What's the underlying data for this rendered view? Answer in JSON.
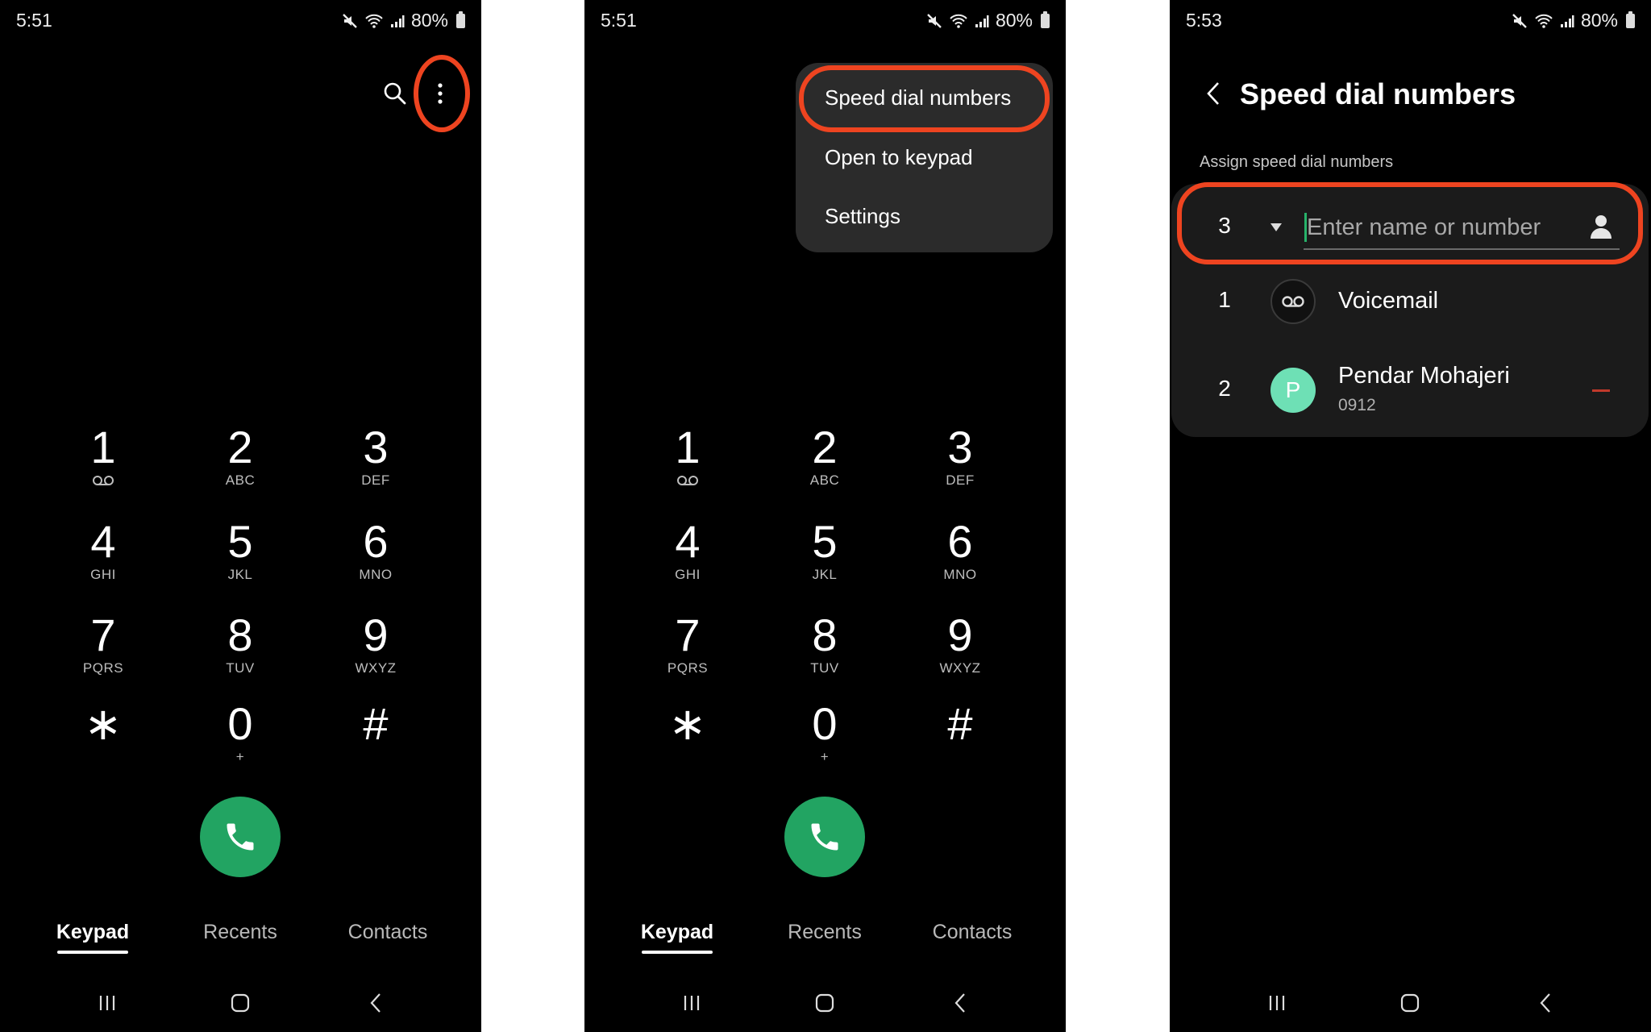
{
  "accent": {
    "callout": "#ee4420",
    "call_green": "#22a462",
    "avatar_mint": "#6ee0b5",
    "remove_red": "#c0392b",
    "caret_green": "#27b36a"
  },
  "panels": [
    {
      "status_bar": {
        "time": "5:51",
        "battery": "80%",
        "icons": [
          "mute-icon",
          "wifi-icon",
          "signal-icon",
          "battery-icon"
        ]
      },
      "top_actions": {
        "search": "search-icon",
        "more": "more-options-icon"
      },
      "keypad": [
        {
          "digit": "1",
          "letters": "",
          "sub_icon": "voicemail-icon"
        },
        {
          "digit": "2",
          "letters": "ABC"
        },
        {
          "digit": "3",
          "letters": "DEF"
        },
        {
          "digit": "4",
          "letters": "GHI"
        },
        {
          "digit": "5",
          "letters": "JKL"
        },
        {
          "digit": "6",
          "letters": "MNO"
        },
        {
          "digit": "7",
          "letters": "PQRS"
        },
        {
          "digit": "8",
          "letters": "TUV"
        },
        {
          "digit": "9",
          "letters": "WXYZ"
        },
        {
          "digit": "∗",
          "letters": ""
        },
        {
          "digit": "0",
          "letters": "+"
        },
        {
          "digit": "#",
          "letters": ""
        }
      ],
      "tabs": [
        {
          "label": "Keypad",
          "active": true
        },
        {
          "label": "Recents"
        },
        {
          "label": "Contacts"
        }
      ],
      "nav": [
        "recent-apps-icon",
        "home-icon",
        "back-icon"
      ]
    },
    {
      "status_bar": {
        "time": "5:51",
        "battery": "80%"
      },
      "menu": {
        "items": [
          {
            "label": "Speed dial numbers",
            "highlighted": true
          },
          {
            "label": "Open to keypad"
          },
          {
            "label": "Settings"
          }
        ]
      },
      "keypad": [
        {
          "digit": "1",
          "letters": "",
          "sub_icon": "voicemail-icon"
        },
        {
          "digit": "2",
          "letters": "ABC"
        },
        {
          "digit": "3",
          "letters": "DEF"
        },
        {
          "digit": "4",
          "letters": "GHI"
        },
        {
          "digit": "5",
          "letters": "JKL"
        },
        {
          "digit": "6",
          "letters": "MNO"
        },
        {
          "digit": "7",
          "letters": "PQRS"
        },
        {
          "digit": "8",
          "letters": "TUV"
        },
        {
          "digit": "9",
          "letters": "WXYZ"
        },
        {
          "digit": "∗",
          "letters": ""
        },
        {
          "digit": "0",
          "letters": "+"
        },
        {
          "digit": "#",
          "letters": ""
        }
      ],
      "tabs": [
        {
          "label": "Keypad",
          "active": true
        },
        {
          "label": "Recents"
        },
        {
          "label": "Contacts"
        }
      ]
    },
    {
      "status_bar": {
        "time": "5:53",
        "battery": "80%"
      },
      "title": "Speed dial numbers",
      "subtitle": "Assign speed dial numbers",
      "assign_row": {
        "number": "3",
        "input_value": "",
        "input_placeholder": "Enter name or number"
      },
      "entries": [
        {
          "number": "1",
          "name": "Voicemail",
          "avatar": "voicemail-icon"
        },
        {
          "number": "2",
          "name": "Pendar Mohajeri",
          "phone": "0912",
          "avatar_letter": "P"
        }
      ]
    }
  ]
}
